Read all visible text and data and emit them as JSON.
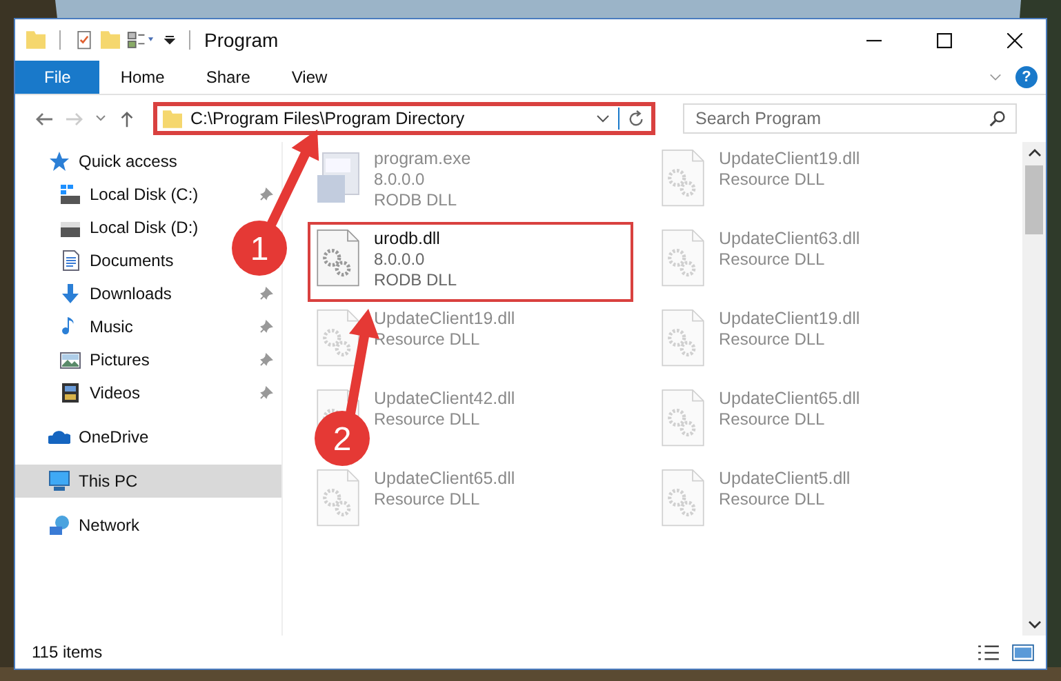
{
  "window": {
    "title": "Program"
  },
  "ribbon_tabs": [
    {
      "label": "File",
      "selected": true
    },
    {
      "label": "Home",
      "selected": false
    },
    {
      "label": "Share",
      "selected": false
    },
    {
      "label": "View",
      "selected": false
    }
  ],
  "help_glyph": "?",
  "address": {
    "value": "C:\\Program Files\\Program Directory",
    "highlighted": true
  },
  "search": {
    "placeholder": "Search Program"
  },
  "nav": [
    {
      "label": "Quick access",
      "kind": "star",
      "selected": false,
      "children": [
        {
          "label": "Local Disk (C:)",
          "kind": "drive-windows",
          "pinned": true,
          "selected": false
        },
        {
          "label": "Local Disk (D:)",
          "kind": "drive",
          "selected": false
        },
        {
          "label": "Documents",
          "kind": "documents",
          "selected": false
        },
        {
          "label": "Downloads",
          "kind": "downloads",
          "pinned": true,
          "selected": false
        },
        {
          "label": "Music",
          "kind": "music",
          "pinned": true,
          "selected": false
        },
        {
          "label": "Pictures",
          "kind": "pictures",
          "pinned": true,
          "selected": false
        },
        {
          "label": "Videos",
          "kind": "videos",
          "pinned": true,
          "selected": false
        }
      ]
    },
    {
      "label": "OneDrive",
      "kind": "cloud",
      "selected": false
    },
    {
      "label": "This PC",
      "kind": "pc",
      "selected": true
    },
    {
      "label": "Network",
      "kind": "network",
      "selected": false
    }
  ],
  "files": [
    {
      "name": "program.exe",
      "lines": [
        "8.0.0.0",
        "RODB DLL"
      ],
      "kind": "exe",
      "faded": true,
      "highlighted": false
    },
    {
      "name": "UpdateClient19.dll",
      "lines": [
        "Resource DLL"
      ],
      "kind": "dll",
      "faded": true,
      "highlighted": false
    },
    {
      "name": "urodb.dll",
      "lines": [
        "8.0.0.0",
        "RODB DLL"
      ],
      "kind": "dll",
      "faded": false,
      "highlighted": true
    },
    {
      "name": "UpdateClient63.dll",
      "lines": [
        "Resource DLL"
      ],
      "kind": "dll",
      "faded": true,
      "highlighted": false
    },
    {
      "name": "UpdateClient19.dll",
      "lines": [
        "Resource DLL"
      ],
      "kind": "dll",
      "faded": true,
      "highlighted": false
    },
    {
      "name": "UpdateClient19.dll",
      "lines": [
        "Resource DLL"
      ],
      "kind": "dll",
      "faded": true,
      "highlighted": false
    },
    {
      "name": "UpdateClient42.dll",
      "lines": [
        "Resource DLL"
      ],
      "kind": "dll",
      "faded": true,
      "highlighted": false
    },
    {
      "name": "UpdateClient65.dll",
      "lines": [
        "Resource DLL"
      ],
      "kind": "dll",
      "faded": true,
      "highlighted": false
    },
    {
      "name": "UpdateClient65.dll",
      "lines": [
        "Resource DLL"
      ],
      "kind": "dll",
      "faded": true,
      "highlighted": false
    },
    {
      "name": "UpdateClient5.dll",
      "lines": [
        "Resource DLL"
      ],
      "kind": "dll",
      "faded": true,
      "highlighted": false
    }
  ],
  "status_bar": {
    "item_count": "115 items"
  },
  "annotations": [
    {
      "label": "1"
    },
    {
      "label": "2"
    }
  ]
}
